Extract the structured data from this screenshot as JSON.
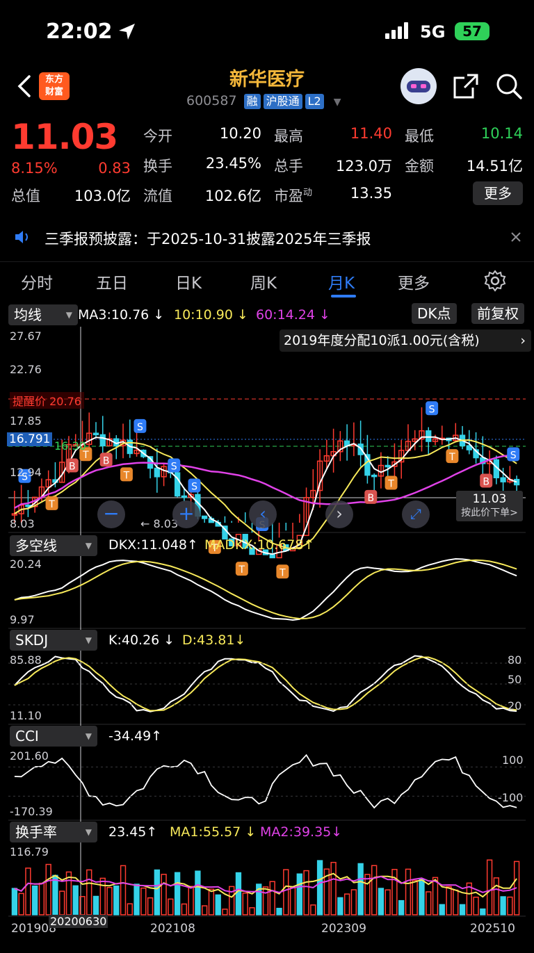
{
  "status_bar": {
    "time": "22:02",
    "network": "5G",
    "battery": "57"
  },
  "header": {
    "app_badge_line1": "东方",
    "app_badge_line2": "财富",
    "stock_name": "新华医疗",
    "stock_code": "600587",
    "tags": [
      "融",
      "沪股通",
      "L2"
    ]
  },
  "quote": {
    "price": "11.03",
    "change_pct": "8.15%",
    "change_amt": "0.83",
    "fields": [
      {
        "label": "今开",
        "value": "10.20"
      },
      {
        "label": "最高",
        "value": "11.40"
      },
      {
        "label": "最低",
        "value": "10.14"
      },
      {
        "label": "换手",
        "value": "23.45%"
      },
      {
        "label": "总手",
        "value": "123.0万"
      },
      {
        "label": "金额",
        "value": "14.51亿"
      },
      {
        "label": "总值",
        "value": "103.0亿"
      },
      {
        "label": "流值",
        "value": "102.6亿"
      },
      {
        "label": "市盈",
        "value": "13.35"
      }
    ],
    "pe_sup": "动",
    "more_label": "更多"
  },
  "notice": {
    "text": "三季报预披露：于2025-10-31披露2025年三季报"
  },
  "tabs": [
    "分时",
    "五日",
    "日K",
    "周K",
    "月K",
    "更多"
  ],
  "main_chart": {
    "selector": "均线",
    "ma3": "MA3:10.76",
    "ma10": "10:10.90",
    "ma60": "60:14.24",
    "dk_button": "DK点",
    "fq_button": "前复权",
    "dividend_note": "2019年度分配10派1.00元(含税)",
    "y_ticks": [
      "27.67",
      "22.76",
      "17.85",
      "12.94",
      "8.03"
    ],
    "alert_label": "提醒价 20.76",
    "cursor_price": "16.791",
    "green_level": "16.30",
    "low_label": "8.03",
    "last_price": "11.03",
    "order_hint": "按此价下单>",
    "color_red": "#ff3b30",
    "color_cyan": "#35d2e8",
    "color_yellow": "#f7e95a",
    "color_magenta": "#e042e8"
  },
  "dkx": {
    "selector": "多空线",
    "dkx": "DKX:11.048",
    "madkx": "MADKX:10.678",
    "ymax": "20.24",
    "ymin": "9.97"
  },
  "skdj": {
    "selector": "SKDJ",
    "k": "K:40.26",
    "d": "D:43.81",
    "ymax": "85.88",
    "ymin": "11.10",
    "r80": "80",
    "r50": "50",
    "r20": "20"
  },
  "cci": {
    "selector": "CCI",
    "value": "-34.49",
    "ymax": "201.60",
    "ymin": "-170.39",
    "r100": "100",
    "rm100": "-100"
  },
  "turnover": {
    "selector": "换手率",
    "value": "23.45",
    "ma1": "MA1:55.57",
    "ma2": "MA2:39.35",
    "ymax": "116.79"
  },
  "x_axis": {
    "labels": [
      "201908",
      "202108",
      "202309",
      "202510"
    ],
    "cursor_date": "20200630"
  }
}
